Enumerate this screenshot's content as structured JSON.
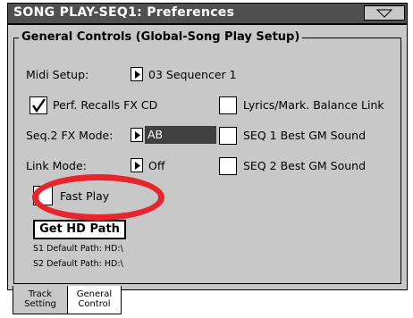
{
  "window": {
    "title": "SONG PLAY-SEQ1: Preferences"
  },
  "group": {
    "title": "General Controls (Global-Song Play Setup)"
  },
  "controls": {
    "midi_setup_label": "Midi Setup:",
    "midi_setup_value": "03 Sequencer 1",
    "perf_recalls_label": "Perf. Recalls FX CD",
    "perf_recalls_checked": true,
    "lyrics_balance_label": "Lyrics/Mark. Balance Link",
    "lyrics_balance_checked": false,
    "seq2_fx_label": "Seq.2 FX Mode:",
    "seq2_fx_value": "AB",
    "seq1_gm_label": "SEQ 1 Best GM Sound",
    "seq1_gm_checked": false,
    "link_mode_label": "Link Mode:",
    "link_mode_value": "Off",
    "seq2_gm_label": "SEQ 2 Best GM Sound",
    "seq2_gm_checked": false,
    "fast_play_label": "Fast Play",
    "fast_play_checked": false
  },
  "hd": {
    "button_label": "Get HD Path",
    "s1_path": "S1 Default Path: HD:\\",
    "s2_path": "S2 Default Path: HD:\\"
  },
  "tabs": [
    {
      "line1": "Track",
      "line2": "Setting",
      "active": false
    },
    {
      "line1": "General",
      "line2": "Control",
      "active": true
    }
  ],
  "colors": {
    "panel": "#c8c8c8",
    "title_bar": "#505050",
    "highlight_circle": "#e8242c"
  }
}
